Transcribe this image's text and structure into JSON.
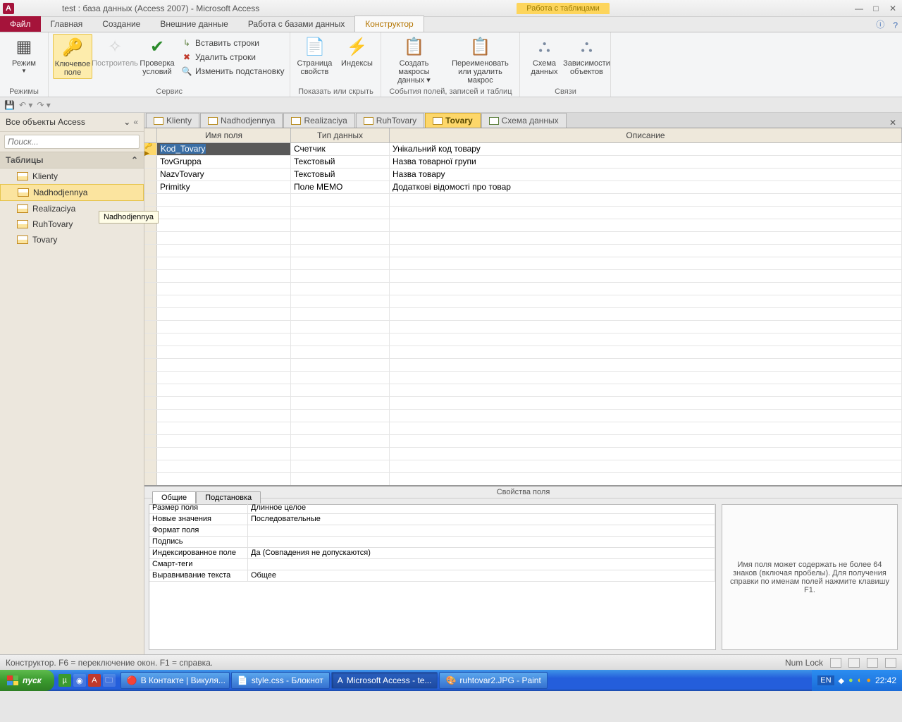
{
  "titlebar": {
    "title": "test : база данных (Access 2007) - Microsoft Access",
    "contextual": "Работа с таблицами",
    "app_letter": "A"
  },
  "ribbon_tabs": {
    "file": "Файл",
    "tabs": [
      "Главная",
      "Создание",
      "Внешние данные",
      "Работа с базами данных",
      "Конструктор"
    ],
    "active_index": 4
  },
  "ribbon": {
    "group_modes": {
      "label": "Режимы",
      "mode_btn": "Режим"
    },
    "group_service": {
      "label": "Сервис",
      "key": "Ключевое поле",
      "builder": "Построитель",
      "validation": "Проверка условий",
      "insert_rows": "Вставить строки",
      "delete_rows": "Удалить строки",
      "modify_lookup": "Изменить подстановку"
    },
    "group_showhide": {
      "label": "Показать или скрыть",
      "prop_sheet": "Страница свойств",
      "indexes": "Индексы"
    },
    "group_events": {
      "label": "События полей, записей и таблиц",
      "create_macros": "Создать макросы данных ▾",
      "rename_delete": "Переименовать или удалить макрос"
    },
    "group_rel": {
      "label": "Связи",
      "schema": "Схема данных",
      "deps": "Зависимости объектов"
    }
  },
  "navpane": {
    "header": "Все объекты Access",
    "search_placeholder": "Поиск...",
    "group": "Таблицы",
    "items": [
      "Klienty",
      "Nadhodjennya",
      "Realizaciya",
      "RuhTovary",
      "Tovary"
    ],
    "selected_index": 1,
    "tooltip": "Nadhodjennya"
  },
  "doctabs": {
    "tabs": [
      {
        "label": "Klienty",
        "type": "table"
      },
      {
        "label": "Nadhodjennya",
        "type": "table"
      },
      {
        "label": "Realizaciya",
        "type": "table"
      },
      {
        "label": "RuhTovary",
        "type": "table"
      },
      {
        "label": "Tovary",
        "type": "table",
        "active": true
      },
      {
        "label": "Схема данных",
        "type": "rel"
      }
    ]
  },
  "design_grid": {
    "headers": {
      "name": "Имя поля",
      "type": "Тип данных",
      "desc": "Описание"
    },
    "rows": [
      {
        "key": true,
        "name": "Kod_Tovary",
        "type": "Счетчик",
        "desc": "Унікальний код товару"
      },
      {
        "name": "TovGruppa",
        "type": "Текстовый",
        "desc": "Назва товарної групи"
      },
      {
        "name": "NazvTovary",
        "type": "Текстовый",
        "desc": "Назва товару"
      },
      {
        "name": "Primitky",
        "type": "Поле МЕМО",
        "desc": "Додаткові відомості про товар"
      }
    ],
    "active_row": 0,
    "empty_rows": 25
  },
  "field_props": {
    "title": "Свойства поля",
    "tabs": [
      "Общие",
      "Подстановка"
    ],
    "props": [
      [
        "Размер поля",
        "Длинное целое"
      ],
      [
        "Новые значения",
        "Последовательные"
      ],
      [
        "Формат поля",
        ""
      ],
      [
        "Подпись",
        ""
      ],
      [
        "Индексированное поле",
        "Да (Совпадения не допускаются)"
      ],
      [
        "Смарт-теги",
        ""
      ],
      [
        "Выравнивание текста",
        "Общее"
      ]
    ],
    "help": "Имя поля может содержать не более 64 знаков (включая пробелы). Для получения справки по именам полей нажмите клавишу F1."
  },
  "statusbar": {
    "left": "Конструктор.  F6 = переключение окон.  F1 = справка.",
    "numlock": "Num Lock"
  },
  "taskbar": {
    "start": "пуск",
    "tasks": [
      {
        "label": "В Контакте | Викуля...",
        "app": "opera"
      },
      {
        "label": "style.css - Блокнот",
        "app": "notepad"
      },
      {
        "label": "Microsoft Access - te...",
        "app": "access",
        "active": true
      },
      {
        "label": "ruhtovar2.JPG - Paint",
        "app": "paint"
      }
    ],
    "lang": "EN",
    "clock": "22:42"
  }
}
